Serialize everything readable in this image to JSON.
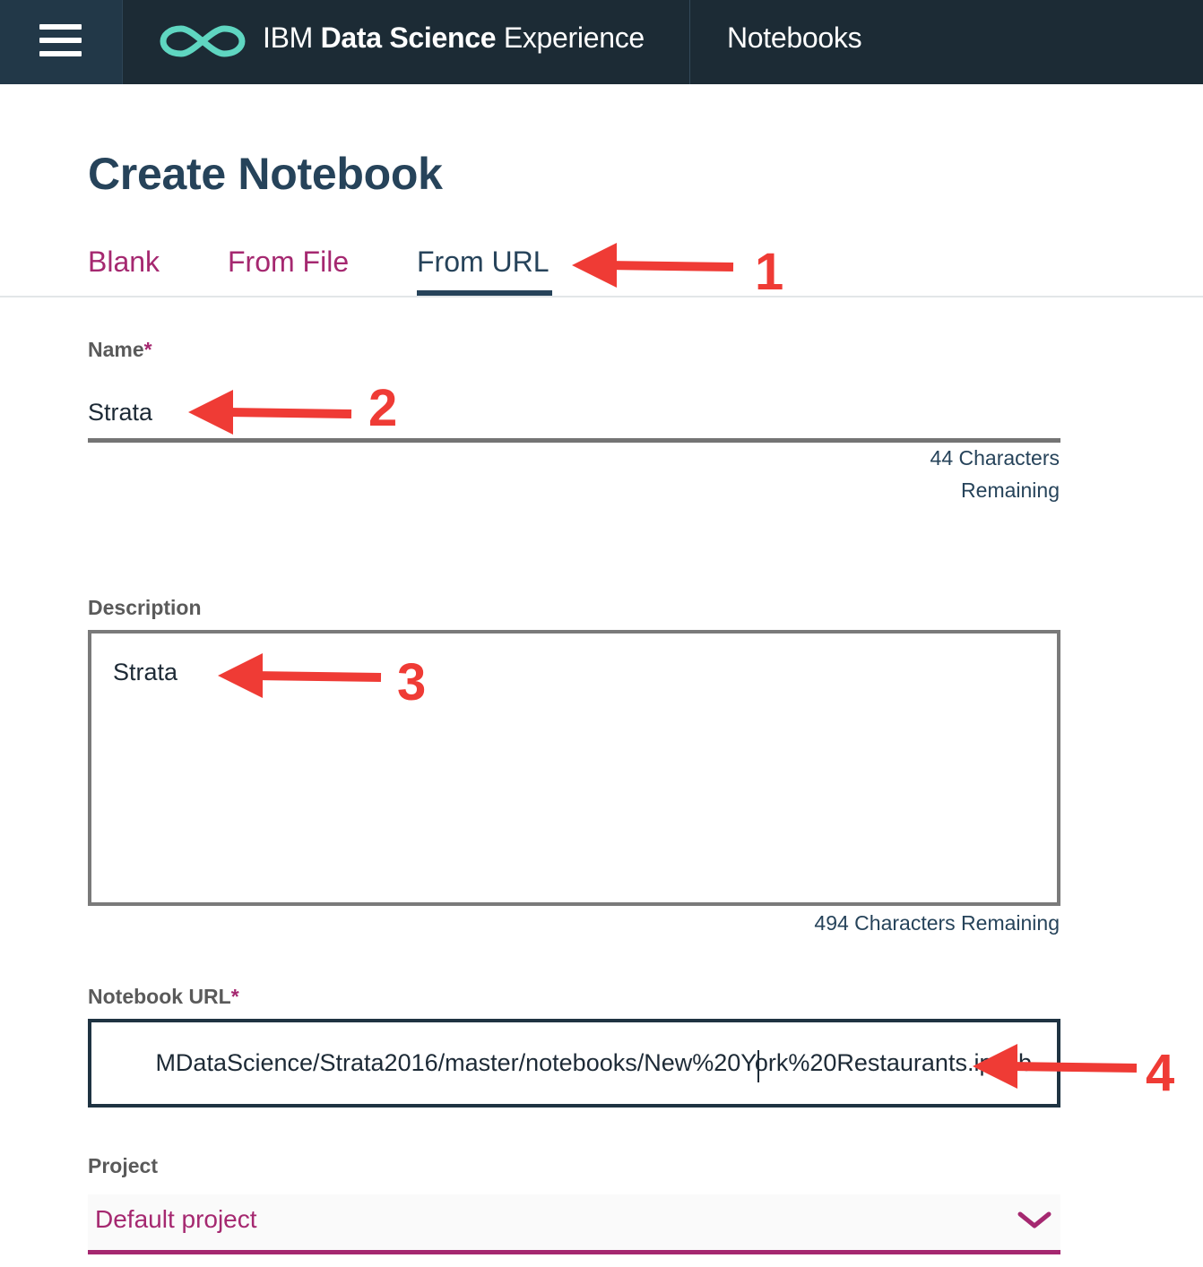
{
  "topbar": {
    "brand_prefix": "IBM",
    "brand_bold": "Data Science",
    "brand_suffix": "Experience",
    "section": "Notebooks"
  },
  "page": {
    "title": "Create Notebook"
  },
  "tabs": [
    {
      "label": "Blank",
      "active": false
    },
    {
      "label": "From File",
      "active": false
    },
    {
      "label": "From URL",
      "active": true
    }
  ],
  "form": {
    "name": {
      "label": "Name",
      "required_mark": "*",
      "value": "Strata",
      "counter_line1": "44 Characters",
      "counter_line2": "Remaining"
    },
    "description": {
      "label": "Description",
      "value": "Strata",
      "counter": "494 Characters Remaining"
    },
    "url": {
      "label": "Notebook URL",
      "required_mark": "*",
      "visible_value": "MDataScience/Strata2016/master/notebooks/New%20York%20Restaurants.ipynb"
    },
    "project": {
      "label": "Project",
      "selected": "Default project"
    }
  },
  "annotations": [
    {
      "number": "1",
      "target": "tab-from-url"
    },
    {
      "number": "2",
      "target": "name-input"
    },
    {
      "number": "3",
      "target": "description-textarea"
    },
    {
      "number": "4",
      "target": "notebook-url-input"
    }
  ],
  "colors": {
    "topbar": "#1c2b35",
    "brand_teal": "#5fd6c1",
    "title": "#26435a",
    "accent_magenta": "#a52870",
    "annotation_red": "#ef3b35"
  },
  "icons": {
    "menu": "hamburger-icon",
    "logo": "infinity-logo-icon",
    "select": "chevron-down-icon",
    "annotation": "arrow-left-icon"
  }
}
